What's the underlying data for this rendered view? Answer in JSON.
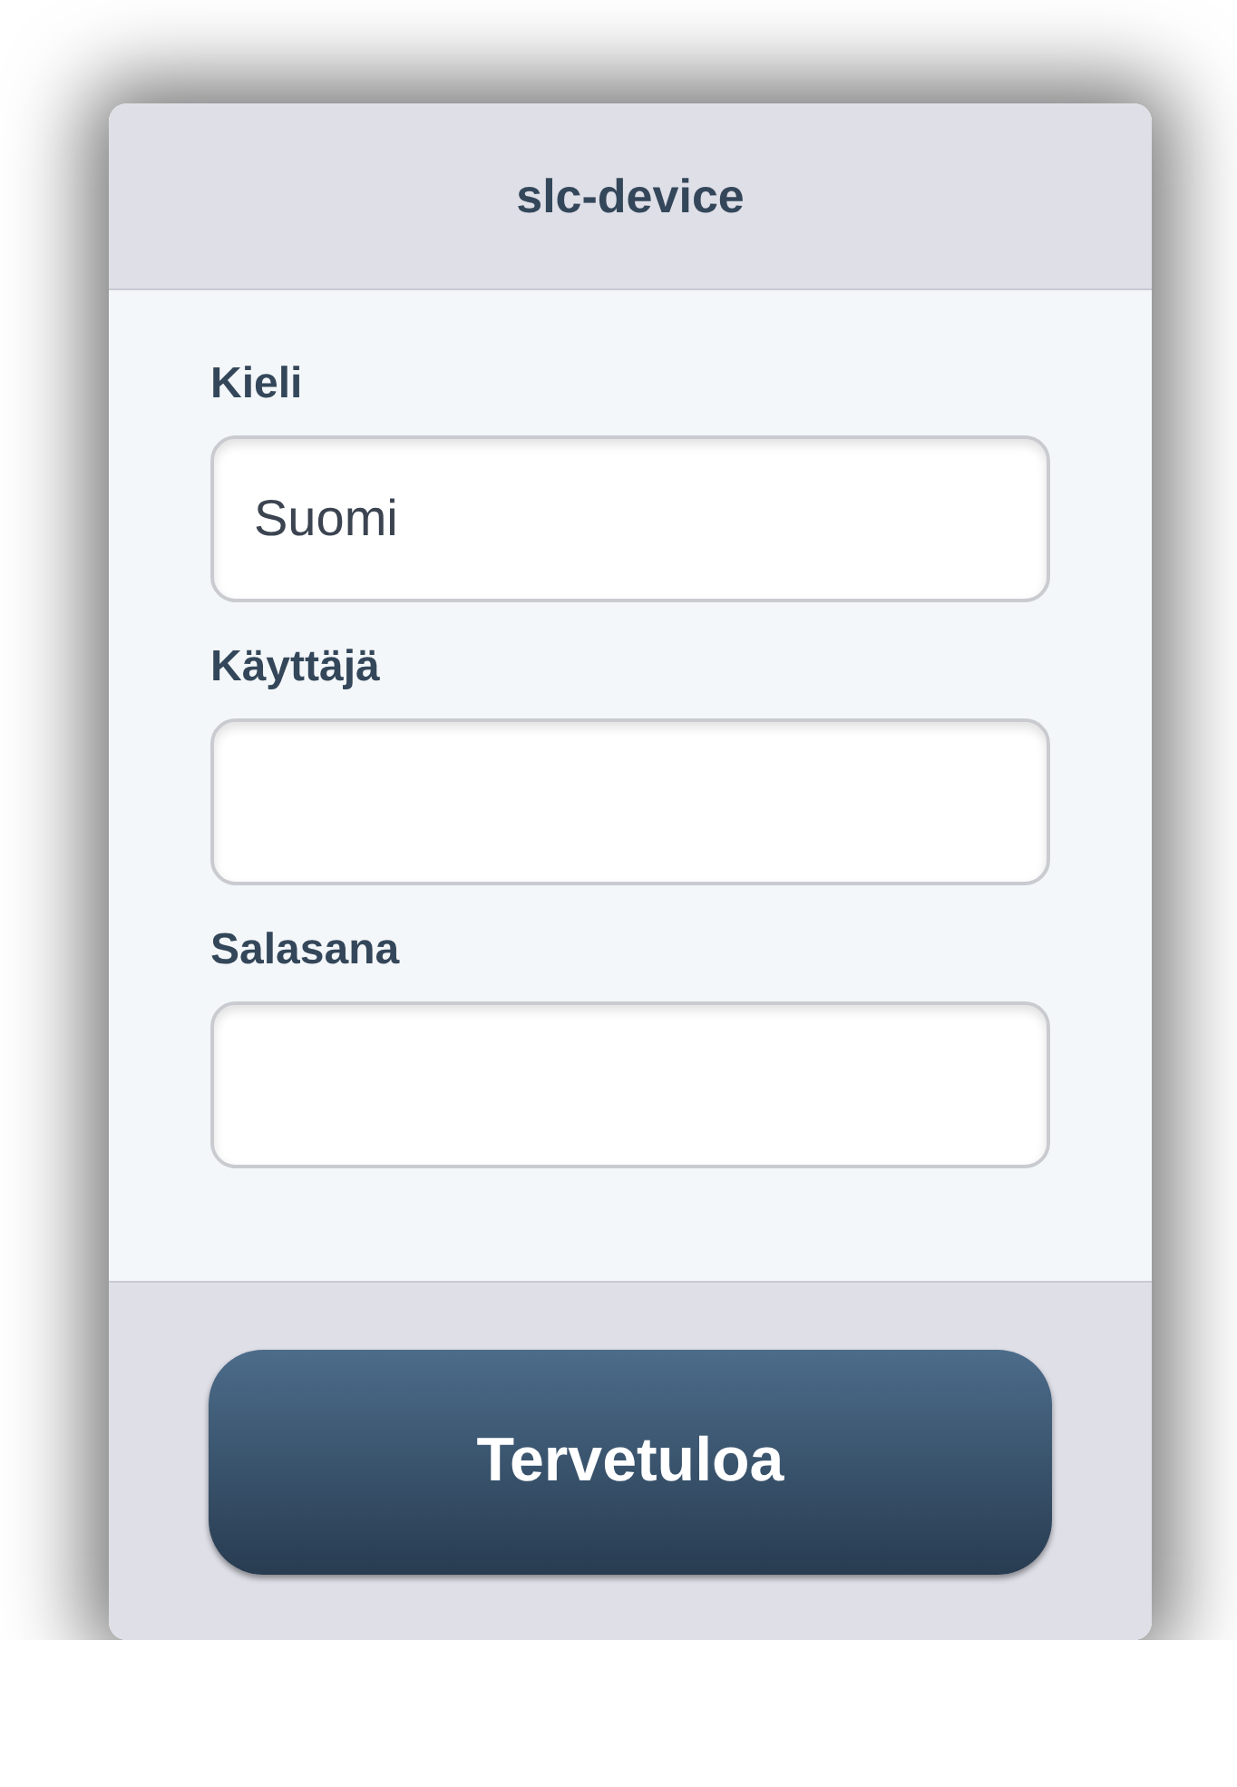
{
  "header": {
    "title": "slc-device"
  },
  "fields": [
    {
      "label": "Kieli",
      "value": "Suomi"
    },
    {
      "label": "Käyttäjä"
    },
    {
      "label": "Salasana"
    }
  ],
  "footer": {
    "button": "Tervetuloa"
  }
}
